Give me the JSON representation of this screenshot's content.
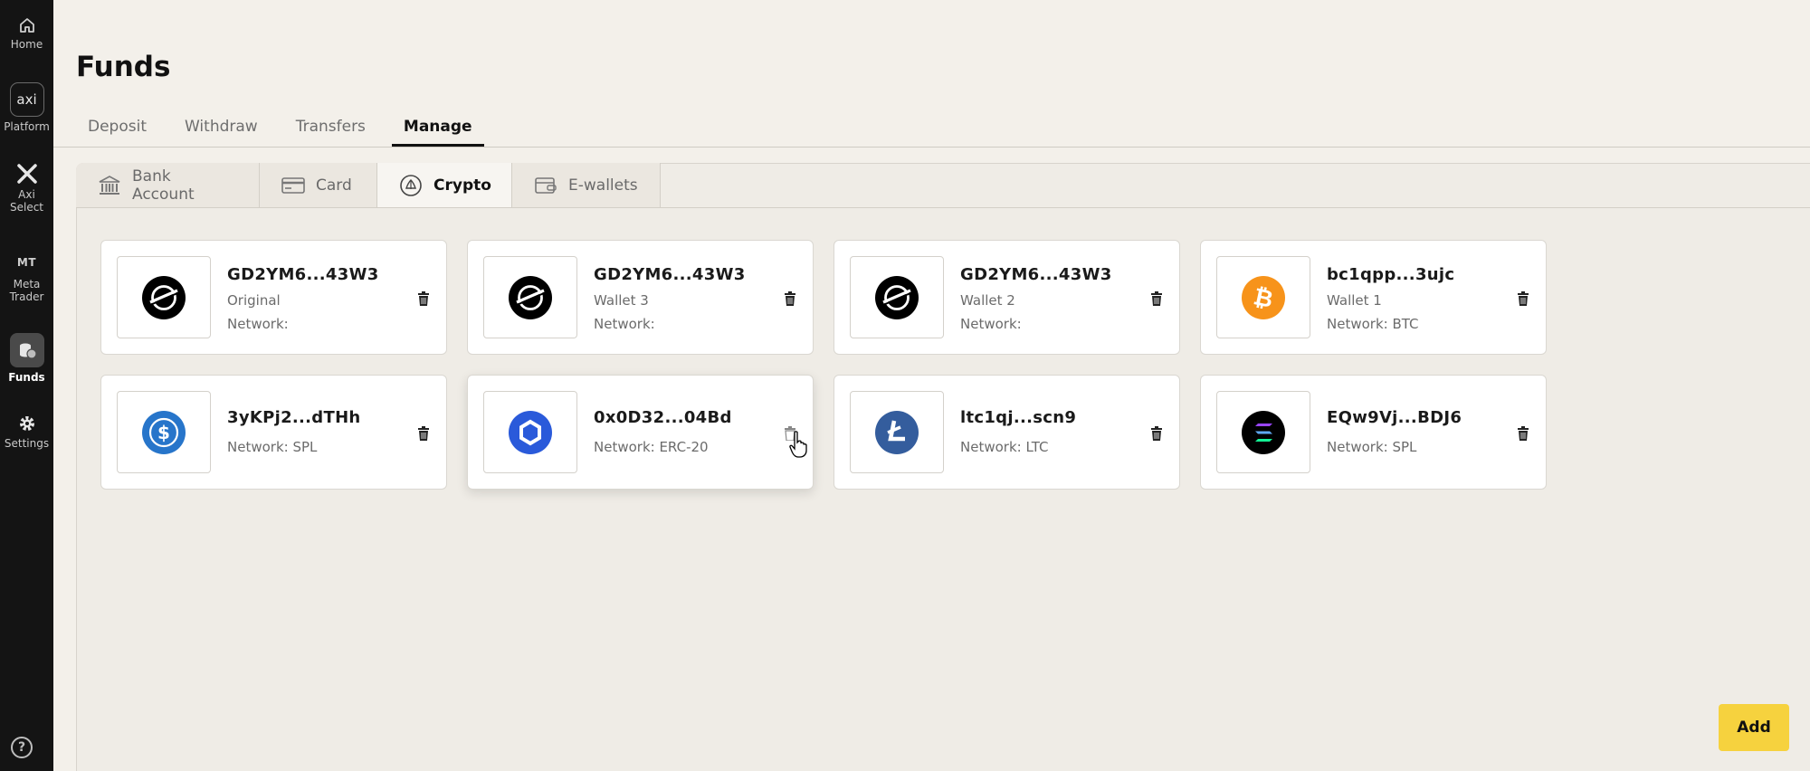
{
  "sidebar": {
    "items": [
      {
        "label": "Home",
        "icon": "home-icon"
      },
      {
        "label": "Platform",
        "badge": "axi",
        "icon": "platform-icon"
      },
      {
        "label": "Axi Select",
        "icon": "axi-select-icon"
      },
      {
        "label": "Meta Trader",
        "badge": "MT",
        "icon": "metatrader-icon"
      },
      {
        "label": "Funds",
        "icon": "funds-icon",
        "active": true
      },
      {
        "label": "Settings",
        "icon": "gear-icon"
      }
    ],
    "help": "?"
  },
  "page": {
    "title": "Funds"
  },
  "tabs": [
    {
      "label": "Deposit"
    },
    {
      "label": "Withdraw"
    },
    {
      "label": "Transfers"
    },
    {
      "label": "Manage",
      "active": true
    }
  ],
  "subtabs": [
    {
      "label": "Bank Account",
      "icon": "bank-icon"
    },
    {
      "label": "Card",
      "icon": "card-icon"
    },
    {
      "label": "Crypto",
      "icon": "crypto-icon",
      "active": true
    },
    {
      "label": "E-wallets",
      "icon": "ewallet-icon"
    }
  ],
  "wallets": [
    {
      "address": "GD2YM6...43W3",
      "name": "Original",
      "network": "Network:",
      "coin": "stellar",
      "coin_color": "#000000"
    },
    {
      "address": "GD2YM6...43W3",
      "name": "Wallet 3",
      "network": "Network:",
      "coin": "stellar",
      "coin_color": "#000000"
    },
    {
      "address": "GD2YM6...43W3",
      "name": "Wallet 2",
      "network": "Network:",
      "coin": "stellar",
      "coin_color": "#000000"
    },
    {
      "address": "bc1qpp...3ujc",
      "name": "Wallet 1",
      "network": "Network: BTC",
      "coin": "bitcoin",
      "coin_color": "#f7931a"
    },
    {
      "address": "3yKPj2...dTHh",
      "network": "Network: SPL",
      "coin": "usdc",
      "coin_color": "#2775ca"
    },
    {
      "address": "0x0D32...04Bd",
      "network": "Network: ERC-20",
      "coin": "chainlink",
      "coin_color": "#2a5ada"
    },
    {
      "address": "ltc1qj...scn9",
      "network": "Network: LTC",
      "coin": "litecoin",
      "coin_color": "#345d9d"
    },
    {
      "address": "EQw9Vj...BDJ6",
      "network": "Network: SPL",
      "coin": "solana",
      "coin_color": "#000000"
    }
  ],
  "actions": {
    "add_label": "Add"
  },
  "colors": {
    "accent": "#f6d23e",
    "sidebar_bg": "#141414",
    "page_bg": "#f3f0ea"
  }
}
